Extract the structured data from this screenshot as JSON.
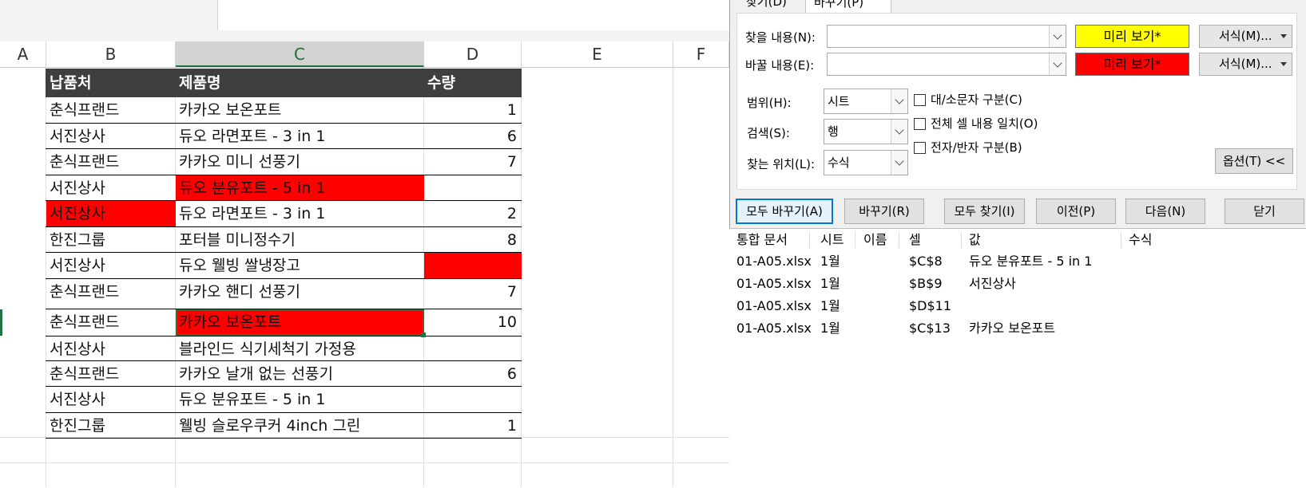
{
  "columns": [
    "A",
    "B",
    "C",
    "D",
    "E",
    "F"
  ],
  "table": {
    "headers": [
      "납품처",
      "제품명",
      "수량"
    ],
    "rows": [
      {
        "b": "춘식프랜드",
        "c": "카카오 보온포트",
        "d": "1"
      },
      {
        "b": "서진상사",
        "c": "듀오 라면포트 - 3 in 1",
        "d": "6"
      },
      {
        "b": "춘식프랜드",
        "c": "카카오 미니 선풍기",
        "d": "7"
      },
      {
        "b": "서진상사",
        "c": "듀오 분유포트 - 5 in 1",
        "d": ""
      },
      {
        "b": "서진상사",
        "c": "듀오 라면포트 - 3 in 1",
        "d": "2"
      },
      {
        "b": "한진그룹",
        "c": "포터블 미니정수기",
        "d": "8"
      },
      {
        "b": "서진상사",
        "c": "듀오 웰빙 쌀냉장고",
        "d": ""
      },
      {
        "b": "춘식프랜드",
        "c": "카카오 핸디 선풍기",
        "d": "7"
      },
      {
        "b": "춘식프랜드",
        "c": "카카오 보온포트",
        "d": "10"
      },
      {
        "b": "서진상사",
        "c": "블라인드 식기세척기 가정용",
        "d": ""
      },
      {
        "b": "춘식프랜드",
        "c": "카카오 날개 없는 선풍기",
        "d": "6"
      },
      {
        "b": "서진상사",
        "c": "듀오 분유포트 - 5 in 1",
        "d": ""
      },
      {
        "b": "한진그룹",
        "c": "웰빙 슬로우쿠커 4inch 그린",
        "d": "1"
      }
    ]
  },
  "dialog": {
    "tabs": {
      "find": "찾기(D)",
      "replace": "바꾸기(P)"
    },
    "find_label": "찾을 내용(N):",
    "replace_label": "바꿀 내용(E):",
    "find_value": "",
    "replace_value": "",
    "preview_label": "미리 보기*",
    "format_label": "서식(M)...",
    "scope_label": "범위(H):",
    "scope_value": "시트",
    "search_label": "검색(S):",
    "search_value": "행",
    "lookin_label": "찾는 위치(L):",
    "lookin_value": "수식",
    "match_case": "대/소문자 구분(C)",
    "match_entire": "전체 셀 내용 일치(O)",
    "match_byte": "전자/반자 구분(B)",
    "options_button": "옵션(T) <<",
    "buttons": {
      "replace_all": "모두 바꾸기(A)",
      "replace": "바꾸기(R)",
      "find_all": "모두 찾기(I)",
      "prev": "이전(P)",
      "next": "다음(N)",
      "close": "닫기"
    },
    "results": {
      "headers": [
        "통합 문서",
        "시트",
        "이름",
        "셀",
        "값",
        "수식"
      ],
      "rows": [
        {
          "book": "01-A05.xlsx",
          "sheet": "1월",
          "name": "",
          "cell": "$C$8",
          "value": "듀오 분유포트 - 5 in 1",
          "formula": ""
        },
        {
          "book": "01-A05.xlsx",
          "sheet": "1월",
          "name": "",
          "cell": "$B$9",
          "value": "서진상사",
          "formula": ""
        },
        {
          "book": "01-A05.xlsx",
          "sheet": "1월",
          "name": "",
          "cell": "$D$11",
          "value": "",
          "formula": ""
        },
        {
          "book": "01-A05.xlsx",
          "sheet": "1월",
          "name": "",
          "cell": "$C$13",
          "value": "카카오 보온포트",
          "formula": ""
        }
      ]
    }
  },
  "colors": {
    "find_preview": "#ffff00",
    "replace_preview": "#ff0000",
    "header_bg": "#3f3f3f",
    "highlight": "#ff0000"
  }
}
